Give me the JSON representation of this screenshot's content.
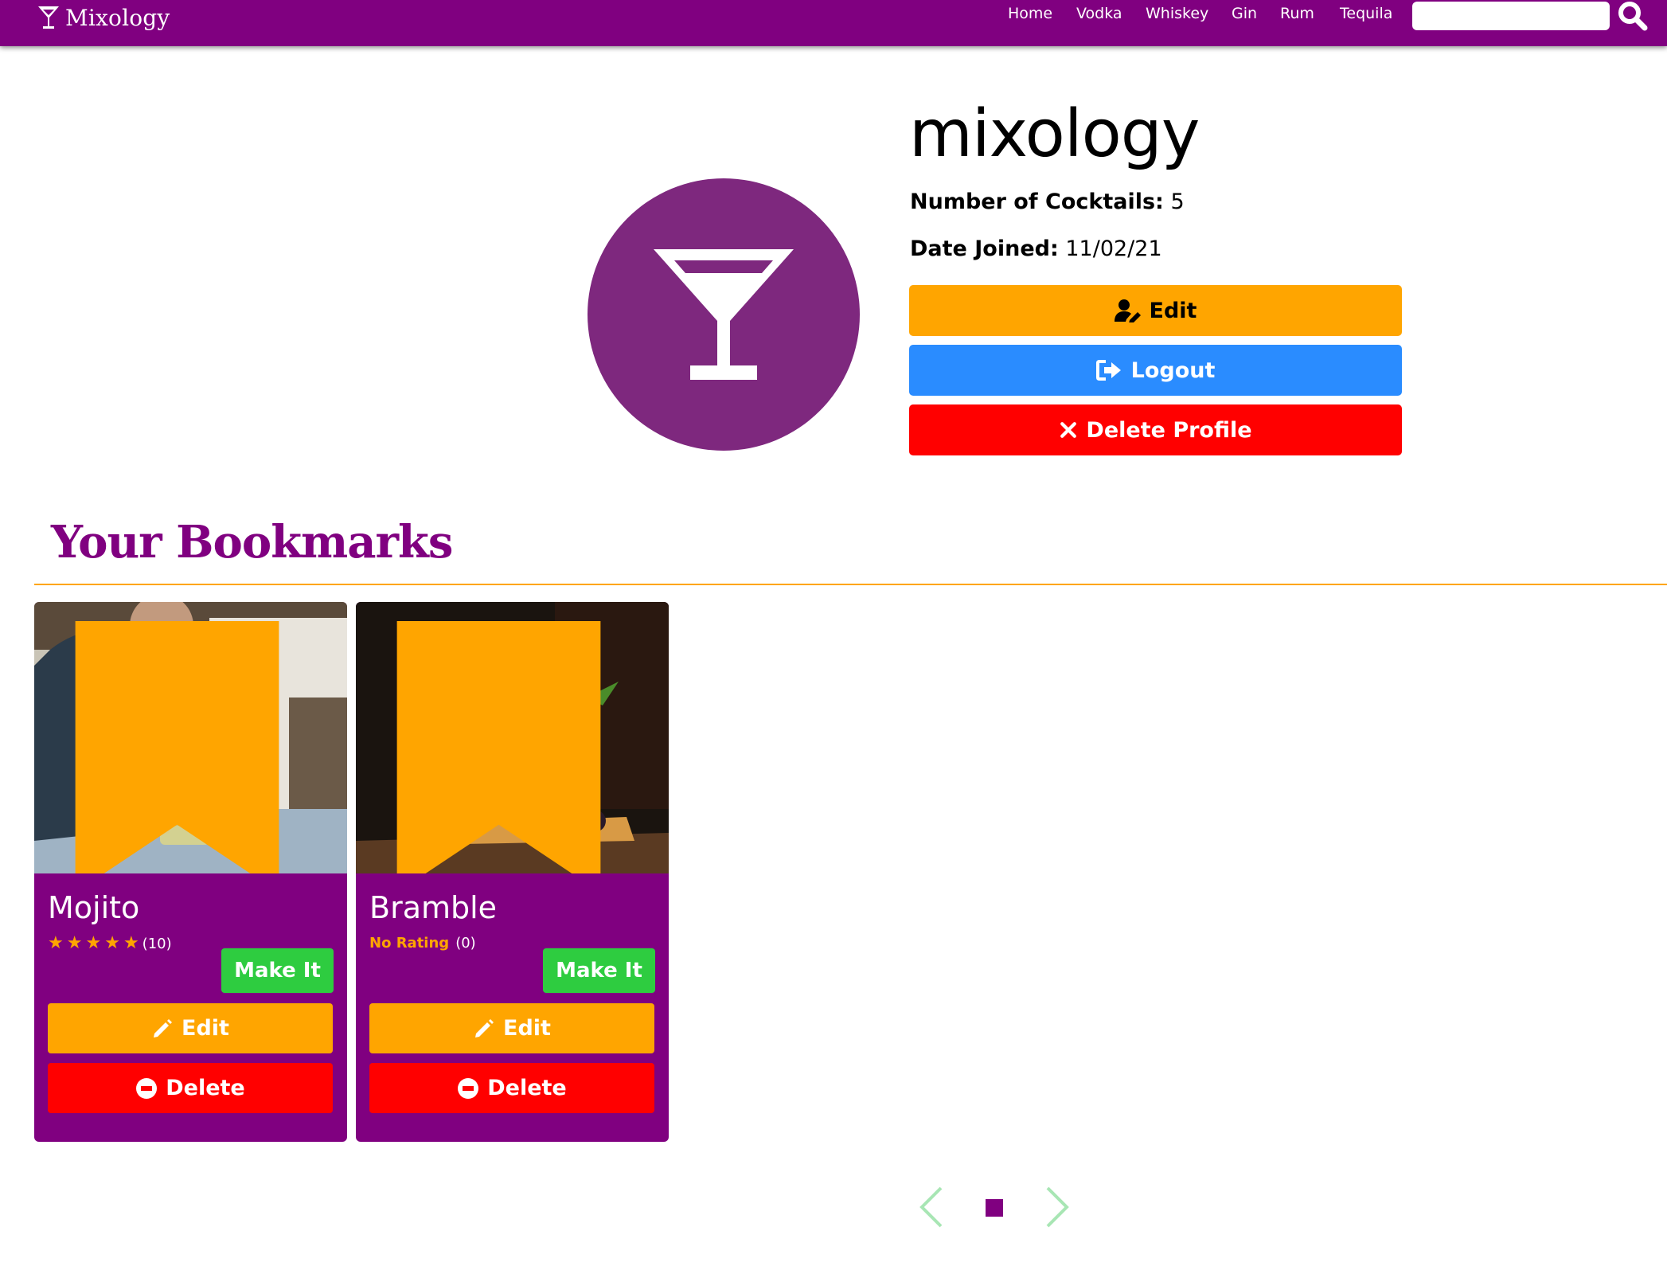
{
  "navbar": {
    "brand": "Mixology",
    "links": [
      {
        "label": "Home"
      },
      {
        "label": "Vodka"
      },
      {
        "label": "Whiskey"
      },
      {
        "label": "Gin"
      },
      {
        "label": "Rum"
      },
      {
        "label": "Tequila"
      }
    ],
    "search": {
      "value": "",
      "placeholder": ""
    },
    "search_icon": "search-icon"
  },
  "profile": {
    "username": "mixology",
    "avatar_icon": "cocktail-glass-icon",
    "cocktails_label": "Number of Cocktails:",
    "cocktails_value": "5",
    "joined_label": "Date Joined:",
    "joined_value": "11/02/21",
    "buttons": {
      "edit": "Edit",
      "logout": "Logout",
      "delete": "Delete Profile"
    }
  },
  "bookmarks": {
    "title": "Your Bookmarks",
    "cards": [
      {
        "name": "Mojito",
        "stars": 5,
        "rating_text": "",
        "rating_count": "(10)",
        "make_label": "Make It",
        "edit_label": "Edit",
        "delete_label": "Delete"
      },
      {
        "name": "Bramble",
        "stars": 0,
        "rating_text": "No Rating",
        "rating_count": "(0)",
        "make_label": "Make It",
        "edit_label": "Edit",
        "delete_label": "Delete"
      }
    ]
  },
  "pagination": {
    "pages": 1,
    "current": 1
  },
  "colors": {
    "brand_purple": "#800080",
    "accent_orange": "#ffa500",
    "logout_blue": "#2a8cff",
    "delete_red": "#ff0000",
    "make_green": "#2ecc40"
  }
}
